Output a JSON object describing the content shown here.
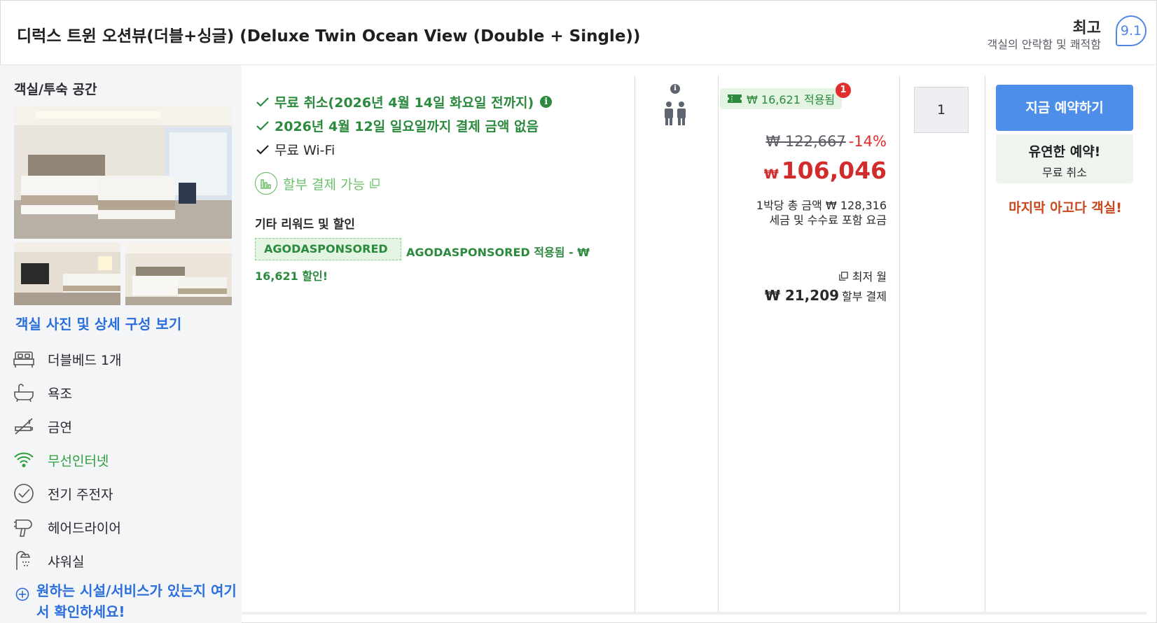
{
  "room": {
    "title": "디럭스 트윈 오션뷰(더블+싱글) (Deluxe Twin Ocean View (Double + Single))",
    "rating_word": "최고",
    "rating_desc": "객실의 안락함 및 쾌적함",
    "rating_score": "9.1"
  },
  "left": {
    "section_label": "객실/투숙 공간",
    "photos_link": "객실 사진 및 상세 구성 보기",
    "amenities": [
      {
        "icon": "bed-icon",
        "label": "더블베드 1개"
      },
      {
        "icon": "bathtub-icon",
        "label": "욕조"
      },
      {
        "icon": "no-smoking-icon",
        "label": "금연"
      },
      {
        "icon": "wifi-icon",
        "label": "무선인터넷",
        "color": "#2e9e3e"
      },
      {
        "icon": "kettle-check-icon",
        "label": "전기 주전자"
      },
      {
        "icon": "hair-dryer-icon",
        "label": "헤어드라이어"
      },
      {
        "icon": "shower-icon",
        "label": "샤워실"
      }
    ],
    "more_link": "원하는 시설/서비스가 있는지 여기서 확인하세요!"
  },
  "benefits": {
    "free_cancel": "무료 취소(2026년 4월 14일 화요일 전까지)",
    "pay_later": "2026년 4월 12일 일요일까지 결제 금액 없음",
    "wifi": "무료 Wi-Fi",
    "installment": "할부 결제 가능",
    "other_label": "기타 리워드 및 할인",
    "promo_tag": "AGODASPONSORED",
    "promo_text": "AGODASPONSORED 적용됨 - ₩ 16,621 할인!"
  },
  "price": {
    "coupon": "₩ 16,621 적용됨",
    "coupon_count": "1",
    "original": "₩ 122,667",
    "discount": "-14%",
    "currency": "₩",
    "final": "106,046",
    "per_night": "1박당 총 금액 ₩ 128,316",
    "tax_note": "세금 및 수수료 포함 요금",
    "min_month": "최저 월",
    "monthly_amount": "₩ 21,209",
    "monthly_label": "할부 결제"
  },
  "booking": {
    "quantity": "1",
    "book_button": "지금 예약하기",
    "flex_title": "유연한 예약!",
    "flex_sub": "무료 취소",
    "last_room": "마지막 아고다 객실!"
  },
  "colors": {
    "accent_blue": "#4d8ee8",
    "link_blue": "#2a6ddc",
    "green": "#2b8a3e",
    "price_red": "#d12c2c",
    "urgency_orange": "#c8471a"
  }
}
